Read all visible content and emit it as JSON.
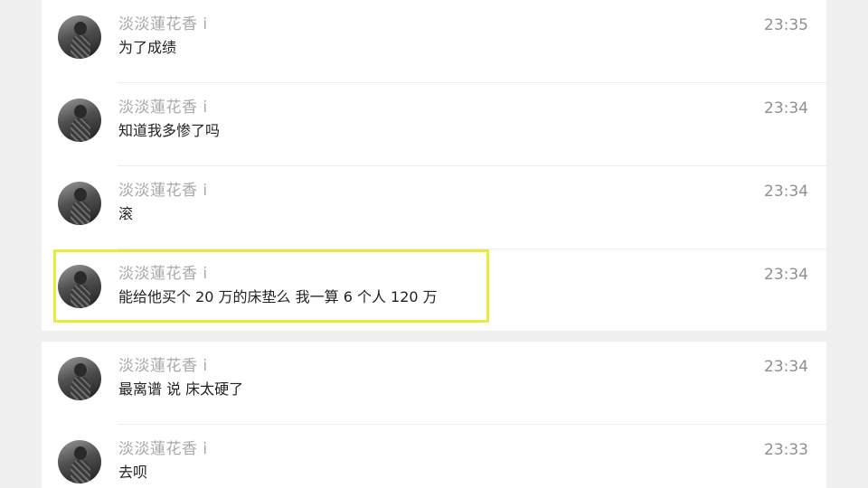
{
  "messages": [
    {
      "sender": "淡淡蓮花香 i",
      "text": "为了成绩",
      "time": "23:35"
    },
    {
      "sender": "淡淡蓮花香 i",
      "text": "知道我多惨了吗",
      "time": "23:34"
    },
    {
      "sender": "淡淡蓮花香 i",
      "text": "滚",
      "time": "23:34"
    },
    {
      "sender": "淡淡蓮花香 i",
      "text": "能给他买个 20 万的床垫么 我一算 6 个人 120 万",
      "time": "23:34"
    },
    {
      "sender": "淡淡蓮花香 i",
      "text": "最离谱 说 床太硬了",
      "time": "23:34"
    },
    {
      "sender": "淡淡蓮花香 i",
      "text": "去呗",
      "time": "23:33"
    }
  ],
  "colors": {
    "highlight": "#e8eb3c",
    "sender": "#a8a8a8",
    "time": "#8f8f8f"
  }
}
